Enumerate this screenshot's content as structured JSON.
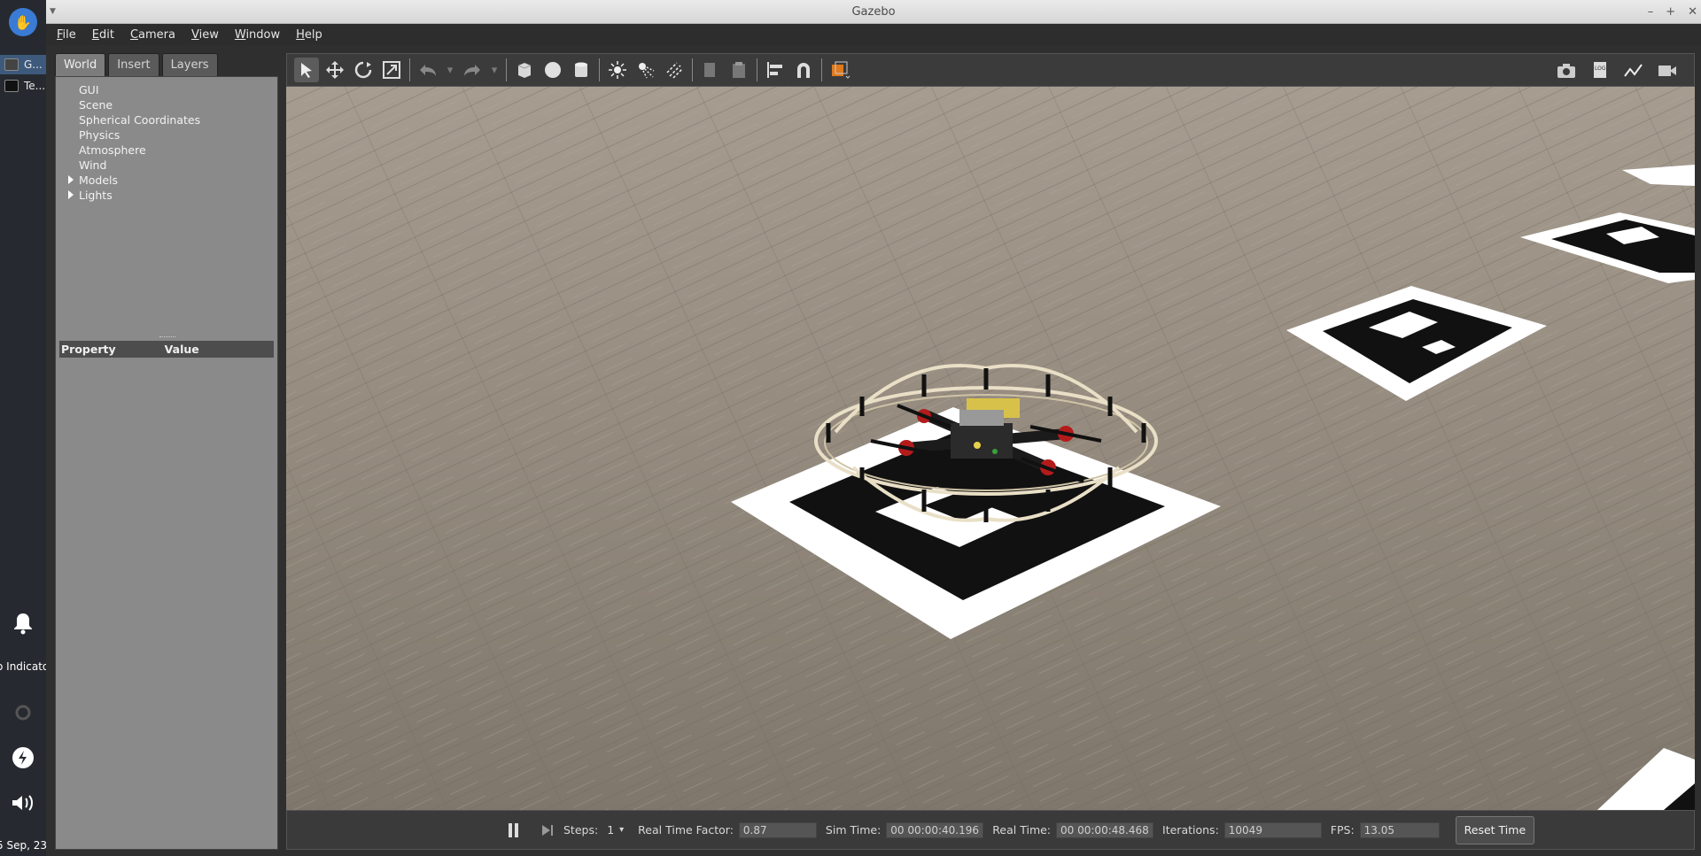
{
  "window": {
    "title": "Gazebo"
  },
  "dock": {
    "tasks": [
      {
        "label": "G..."
      },
      {
        "label": "Te..."
      }
    ],
    "indicator_text": "o Indicato",
    "clock_text": "5 Sep, 23:"
  },
  "menu": [
    "File",
    "Edit",
    "Camera",
    "View",
    "Window",
    "Help"
  ],
  "tabs": [
    "World",
    "Insert",
    "Layers"
  ],
  "tree": {
    "items": [
      "GUI",
      "Scene",
      "Spherical Coordinates",
      "Physics",
      "Atmosphere",
      "Wind",
      "Models",
      "Lights"
    ]
  },
  "properties": {
    "col_property": "Property",
    "col_value": "Value"
  },
  "toolbar": {
    "icons": [
      "select-arrow-icon",
      "translate-icon",
      "rotate-icon",
      "scale-icon",
      "undo-icon",
      "redo-icon",
      "box-icon",
      "sphere-icon",
      "cylinder-icon",
      "point-light-icon",
      "spot-light-icon",
      "directional-light-icon",
      "copy-icon",
      "paste-icon",
      "align-icon",
      "snap-magnet-icon",
      "view-angle-icon",
      "screenshot-icon",
      "log-icon",
      "plot-icon",
      "video-record-icon"
    ]
  },
  "bottombar": {
    "steps_label": "Steps:",
    "steps_value": "1",
    "rtf_label": "Real Time Factor:",
    "rtf_value": "0.87",
    "sim_label": "Sim Time:",
    "sim_value": "00 00:00:40.196",
    "real_label": "Real Time:",
    "real_value": "00 00:00:48.468",
    "iter_label": "Iterations:",
    "iter_value": "10049",
    "fps_label": "FPS:",
    "fps_value": "13.05",
    "reset_label": "Reset Time"
  },
  "colors": {
    "floor": "#8a8276",
    "panel": "#8a8a8a",
    "accent": "#e07a1e"
  }
}
